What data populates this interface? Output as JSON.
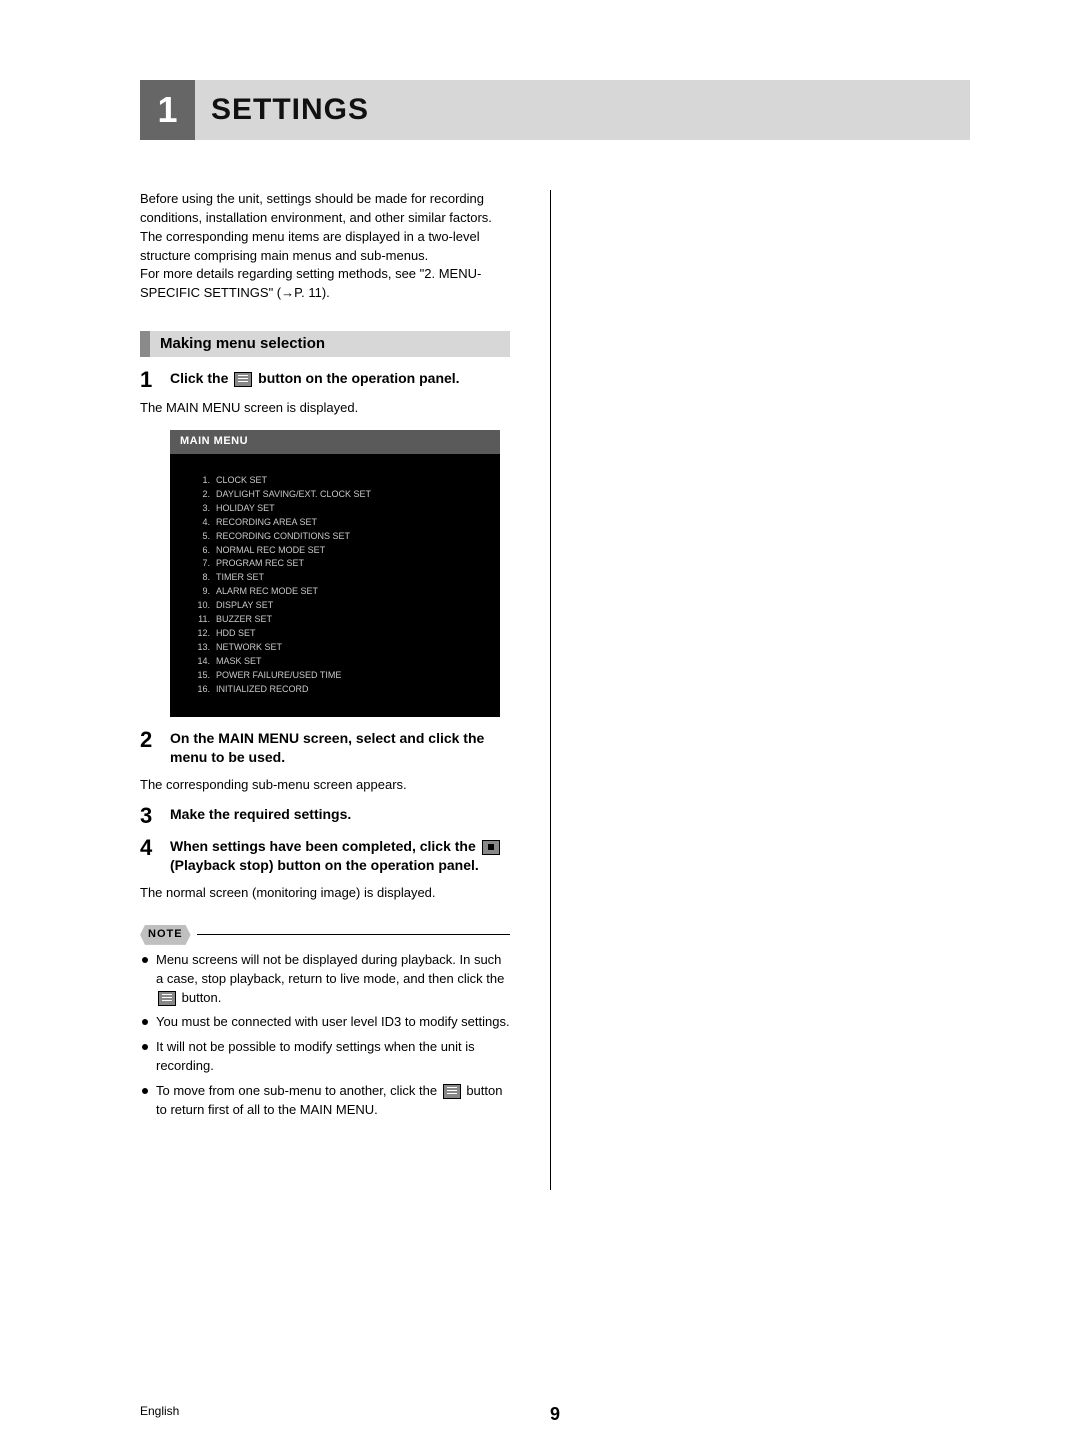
{
  "chapter": {
    "number": "1",
    "title": "SETTINGS"
  },
  "intro": {
    "p1": "Before using the unit, settings should be made for recording conditions, installation environment, and other similar factors. The corresponding menu items are displayed in a two-level structure comprising main menus and sub-menus.",
    "p2": "For more details regarding setting methods, see \"2. MENU-SPECIFIC SETTINGS\" (→P. 11)."
  },
  "section_header": "Making menu selection",
  "steps": {
    "s1": {
      "num": "1",
      "text_a": "Click the ",
      "text_b": " button on the operation panel.",
      "desc": "The MAIN MENU screen is displayed."
    },
    "s2": {
      "num": "2",
      "text": "On the MAIN MENU screen, select and click the menu to be used.",
      "desc": "The corresponding sub-menu screen appears."
    },
    "s3": {
      "num": "3",
      "text": "Make the required settings."
    },
    "s4": {
      "num": "4",
      "text_a": "When settings have been completed, click the ",
      "text_b": " (Playback stop) button on the operation panel.",
      "desc": "The normal screen (monitoring image) is displayed."
    }
  },
  "main_menu": {
    "title": "MAIN MENU",
    "items": [
      {
        "n": "1.",
        "t": "CLOCK SET"
      },
      {
        "n": "2.",
        "t": "DAYLIGHT SAVING/EXT. CLOCK SET"
      },
      {
        "n": "3.",
        "t": "HOLIDAY SET"
      },
      {
        "n": "4.",
        "t": "RECORDING AREA SET"
      },
      {
        "n": "5.",
        "t": "RECORDING CONDITIONS SET"
      },
      {
        "n": "6.",
        "t": "NORMAL REC MODE SET"
      },
      {
        "n": "7.",
        "t": "PROGRAM REC SET"
      },
      {
        "n": "8.",
        "t": "TIMER SET"
      },
      {
        "n": "9.",
        "t": "ALARM REC MODE SET"
      },
      {
        "n": "10.",
        "t": "DISPLAY SET"
      },
      {
        "n": "11.",
        "t": "BUZZER SET"
      },
      {
        "n": "12.",
        "t": "HDD SET"
      },
      {
        "n": "13.",
        "t": "NETWORK SET"
      },
      {
        "n": "14.",
        "t": "MASK SET"
      },
      {
        "n": "15.",
        "t": "POWER FAILURE/USED TIME"
      },
      {
        "n": "16.",
        "t": "INITIALIZED RECORD"
      }
    ]
  },
  "note": {
    "label": "NOTE",
    "items": {
      "n1a": "Menu screens will not be displayed during playback. In such a case, stop playback, return to live mode, and then click the ",
      "n1b": " button.",
      "n2": "You must be connected with user level ID3 to modify settings.",
      "n3": "It will not be possible to modify settings when the unit is recording.",
      "n4a": "To move from one sub-menu to another, click the ",
      "n4b": " button to return first of all to the MAIN MENU."
    }
  },
  "footer": {
    "lang": "English",
    "page": "9"
  }
}
